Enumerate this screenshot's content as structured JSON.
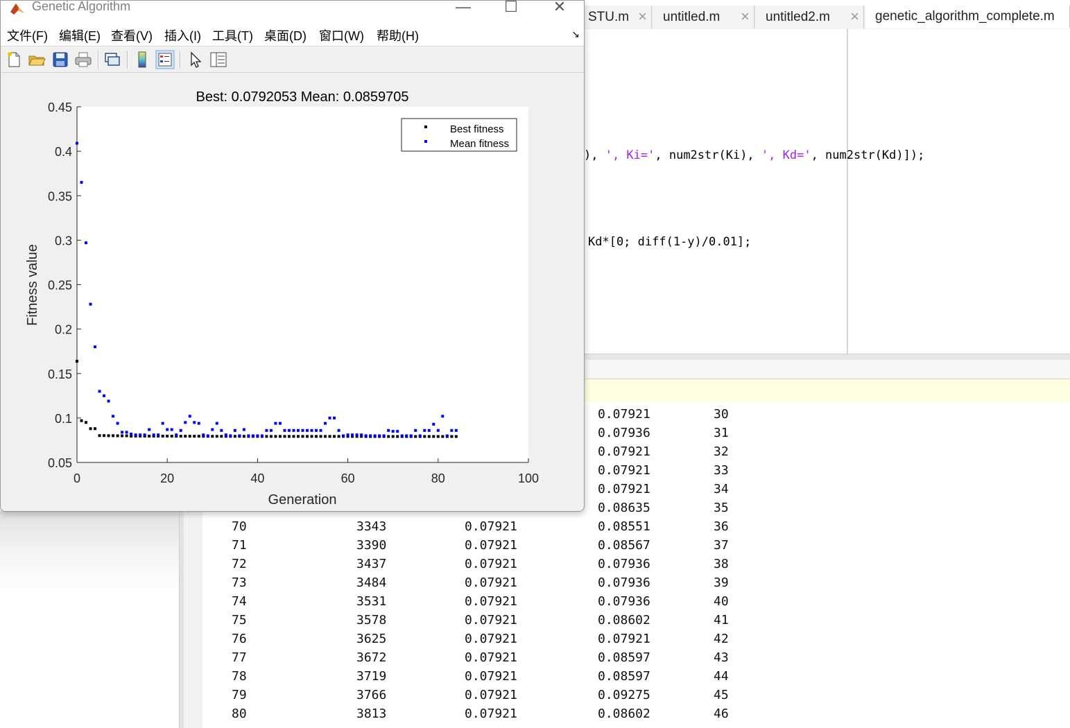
{
  "tabs": [
    {
      "label": "STU.m"
    },
    {
      "label": "untitled.m"
    },
    {
      "label": "untitled2.m"
    },
    {
      "label": "genetic_algorithm_complete.m"
    }
  ],
  "editor": {
    "line1": {
      "p1": "), ",
      "s1": "', Ki='",
      "p2": ", num2str(Ki), ",
      "s2": "', Kd='",
      "p3": ", num2str(Kd)]);"
    },
    "line2": "Kd*[0; diff(1-y)/0.01];"
  },
  "command_rows_partial": [
    {
      "mean": "0.07921",
      "stall": "30"
    },
    {
      "mean": "0.07936",
      "stall": "31"
    },
    {
      "mean": "0.07921",
      "stall": "32"
    },
    {
      "mean": "0.07921",
      "stall": "33"
    },
    {
      "mean": "0.07921",
      "stall": "34"
    },
    {
      "mean": "0.08635",
      "stall": "35"
    }
  ],
  "command_rows": [
    {
      "gen": "70",
      "fcount": "3343",
      "best": "0.07921",
      "mean": "0.08551",
      "stall": "36"
    },
    {
      "gen": "71",
      "fcount": "3390",
      "best": "0.07921",
      "mean": "0.08567",
      "stall": "37"
    },
    {
      "gen": "72",
      "fcount": "3437",
      "best": "0.07921",
      "mean": "0.07936",
      "stall": "38"
    },
    {
      "gen": "73",
      "fcount": "3484",
      "best": "0.07921",
      "mean": "0.07936",
      "stall": "39"
    },
    {
      "gen": "74",
      "fcount": "3531",
      "best": "0.07921",
      "mean": "0.07936",
      "stall": "40"
    },
    {
      "gen": "75",
      "fcount": "3578",
      "best": "0.07921",
      "mean": "0.08602",
      "stall": "41"
    },
    {
      "gen": "76",
      "fcount": "3625",
      "best": "0.07921",
      "mean": "0.07921",
      "stall": "42"
    },
    {
      "gen": "77",
      "fcount": "3672",
      "best": "0.07921",
      "mean": "0.08597",
      "stall": "43"
    },
    {
      "gen": "78",
      "fcount": "3719",
      "best": "0.07921",
      "mean": "0.08597",
      "stall": "44"
    },
    {
      "gen": "79",
      "fcount": "3766",
      "best": "0.07921",
      "mean": "0.09275",
      "stall": "45"
    },
    {
      "gen": "80",
      "fcount": "3813",
      "best": "0.07921",
      "mean": "0.08602",
      "stall": "46"
    }
  ],
  "figure": {
    "title": "Genetic Algorithm",
    "menus": [
      "文件(F)",
      "编辑(E)",
      "查看(V)",
      "插入(I)",
      "工具(T)",
      "桌面(D)",
      "窗口(W)",
      "帮助(H)"
    ],
    "icons": [
      "new-figure-icon",
      "open-icon",
      "save-icon",
      "print-icon",
      "link-plot-icon",
      "colorbar-icon",
      "legend-icon",
      "edit-plot-arrow-icon",
      "property-inspector-icon"
    ]
  },
  "chart_data": {
    "type": "scatter",
    "title": "Best: 0.0792053 Mean: 0.0859705",
    "xlabel": "Generation",
    "ylabel": "Fitness value",
    "xlim": [
      0,
      100
    ],
    "ylim": [
      0.05,
      0.45
    ],
    "xticks": [
      "0",
      "20",
      "40",
      "60",
      "80",
      "100"
    ],
    "yticks": [
      "0.05",
      "0.1",
      "0.15",
      "0.2",
      "0.25",
      "0.3",
      "0.35",
      "0.4",
      "0.45"
    ],
    "legend_position": "top-right",
    "grid": false,
    "series": [
      {
        "name": "Best fitness",
        "color": "#000000",
        "x": [
          0,
          1,
          2,
          3,
          4,
          5,
          6,
          7,
          8,
          9,
          10,
          11,
          12,
          13,
          14,
          15,
          16,
          17,
          18,
          19,
          20,
          21,
          22,
          23,
          24,
          25,
          26,
          27,
          28,
          29,
          30,
          31,
          32,
          33,
          34,
          35,
          36,
          37,
          38,
          39,
          40,
          41,
          42,
          43,
          44,
          45,
          46,
          47,
          48,
          49,
          50,
          51,
          52,
          53,
          54,
          55,
          56,
          57,
          58,
          59,
          60,
          61,
          62,
          63,
          64,
          65,
          66,
          67,
          68,
          69,
          70,
          71,
          72,
          73,
          74,
          75,
          76,
          77,
          78,
          79,
          80,
          81,
          82,
          83,
          84
        ],
        "y": [
          0.1638,
          0.097,
          0.095,
          0.088,
          0.088,
          0.0802,
          0.0802,
          0.0801,
          0.0801,
          0.08,
          0.08,
          0.08,
          0.0796,
          0.0796,
          0.0796,
          0.0796,
          0.0796,
          0.0796,
          0.0796,
          0.0796,
          0.0796,
          0.0796,
          0.0795,
          0.0795,
          0.0795,
          0.0795,
          0.0795,
          0.0795,
          0.0794,
          0.0794,
          0.0794,
          0.0794,
          0.0794,
          0.0794,
          0.0794,
          0.0794,
          0.0794,
          0.0794,
          0.0793,
          0.0793,
          0.0793,
          0.0793,
          0.0793,
          0.0793,
          0.0793,
          0.0793,
          0.0793,
          0.0793,
          0.0793,
          0.0793,
          0.0793,
          0.0793,
          0.0793,
          0.0793,
          0.0793,
          0.0793,
          0.0793,
          0.0793,
          0.0793,
          0.0793,
          0.0793,
          0.0793,
          0.0793,
          0.0793,
          0.0792,
          0.0792,
          0.0792,
          0.0792,
          0.0792,
          0.0792,
          0.0792,
          0.0792,
          0.0792,
          0.0792,
          0.0792,
          0.0792,
          0.0792,
          0.0792,
          0.0792,
          0.0792,
          0.0792,
          0.0792,
          0.0792,
          0.0792,
          0.0792
        ]
      },
      {
        "name": "Mean fitness",
        "color": "#0000ff",
        "x": [
          0,
          1,
          2,
          3,
          4,
          5,
          6,
          7,
          8,
          9,
          10,
          11,
          12,
          13,
          14,
          15,
          16,
          17,
          18,
          19,
          20,
          21,
          22,
          23,
          24,
          25,
          26,
          27,
          28,
          29,
          30,
          31,
          32,
          33,
          34,
          35,
          36,
          37,
          38,
          39,
          40,
          41,
          42,
          43,
          44,
          45,
          46,
          47,
          48,
          49,
          50,
          51,
          52,
          53,
          54,
          55,
          56,
          57,
          58,
          59,
          60,
          61,
          62,
          63,
          64,
          65,
          66,
          67,
          68,
          69,
          70,
          71,
          72,
          73,
          74,
          75,
          76,
          77,
          78,
          79,
          80,
          81,
          82,
          83,
          84
        ],
        "y": [
          0.409,
          0.365,
          0.297,
          0.228,
          0.18,
          0.13,
          0.125,
          0.119,
          0.102,
          0.094,
          0.084,
          0.084,
          0.082,
          0.081,
          0.081,
          0.081,
          0.087,
          0.081,
          0.081,
          0.094,
          0.087,
          0.087,
          0.081,
          0.086,
          0.095,
          0.102,
          0.095,
          0.094,
          0.081,
          0.08,
          0.087,
          0.094,
          0.086,
          0.081,
          0.08,
          0.086,
          0.08,
          0.087,
          0.08,
          0.08,
          0.08,
          0.08,
          0.086,
          0.086,
          0.094,
          0.094,
          0.086,
          0.086,
          0.086,
          0.086,
          0.086,
          0.086,
          0.086,
          0.086,
          0.086,
          0.094,
          0.1,
          0.1,
          0.086,
          0.08,
          0.081,
          0.081,
          0.081,
          0.081,
          0.08,
          0.08,
          0.08,
          0.08,
          0.08,
          0.086,
          0.085,
          0.085,
          0.08,
          0.08,
          0.08,
          0.086,
          0.08,
          0.086,
          0.086,
          0.093,
          0.086,
          0.102,
          0.08,
          0.086,
          0.086
        ]
      }
    ]
  }
}
